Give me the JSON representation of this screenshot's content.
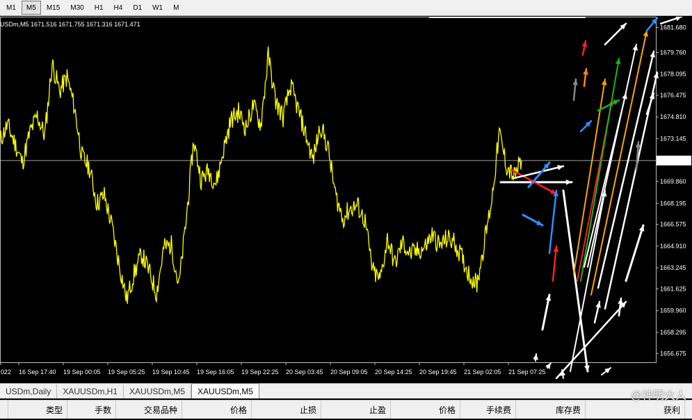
{
  "timeframes": [
    "M1",
    "M5",
    "M15",
    "M30",
    "H1",
    "H4",
    "D1",
    "W1",
    "MN"
  ],
  "active_timeframe": "M5",
  "chart": {
    "info_line": "USDm,M5  1671.516 1671.755 1671.316 1671.471",
    "current_price_label": "1671.471",
    "price_labels": [
      "1681.680",
      "1679.760",
      "1678.095",
      "1676.475",
      "1674.810",
      "1673.145",
      "1671.471",
      "1669.860",
      "1668.195",
      "1666.575",
      "1664.910",
      "1663.245",
      "1661.625",
      "1659.960",
      "1658.295",
      "1656.675"
    ],
    "time_labels": [
      "022",
      "16 Sep 17:40",
      "19 Sep 00:05",
      "19 Sep 05:25",
      "19 Sep 10:45",
      "19 Sep 16:05",
      "19 Sep 22:25",
      "20 Sep 03:45",
      "20 Sep 09:05",
      "20 Sep 14:25",
      "20 Sep 19:45",
      "21 Sep 02:05",
      "21 Sep 07:25"
    ],
    "line_color": "#ffff00",
    "crosshair_color": "#d8d8d8"
  },
  "chart_data": {
    "type": "line",
    "title": "",
    "xlabel": "",
    "ylabel": "",
    "ylim": [
      1656.0,
      1682.5
    ],
    "x": [
      "16 Sep 17:40",
      "19 Sep 00:05",
      "19 Sep 05:25",
      "19 Sep 10:45",
      "19 Sep 16:05",
      "19 Sep 22:25",
      "20 Sep 03:45",
      "20 Sep 09:05",
      "20 Sep 14:25",
      "20 Sep 19:45",
      "21 Sep 02:05",
      "21 Sep 07:25"
    ],
    "series": [
      {
        "values": [
          1673.0,
          1674.2,
          1672.8,
          1671.3,
          1673.6,
          1674.9,
          1673.4,
          1678.9,
          1676.8,
          1677.9,
          1675.5,
          1671.8,
          1670.9,
          1668.2,
          1668.8,
          1666.5,
          1663.5,
          1660.8,
          1662.8,
          1664.3,
          1663.0,
          1661.3,
          1664.8,
          1665.0,
          1661.8,
          1667.0,
          1673.0,
          1670.0,
          1670.7,
          1669.7,
          1672.3,
          1674.6,
          1675.2,
          1674.0,
          1675.7,
          1674.2,
          1679.5,
          1676.0,
          1674.8,
          1677.2,
          1675.4,
          1673.5,
          1671.5,
          1674.2,
          1672.5,
          1668.9,
          1667.0,
          1667.8,
          1668.0,
          1666.8,
          1663.0,
          1662.3,
          1665.5,
          1663.5,
          1665.2,
          1664.3,
          1664.5,
          1664.8,
          1665.8,
          1664.9,
          1665.5,
          1665.2,
          1664.0,
          1662.7,
          1662.0,
          1665.2,
          1668.5,
          1673.6,
          1671.0,
          1670.2,
          1671.5
        ],
        "color": "#ffff00"
      }
    ],
    "current_price": 1671.471,
    "grid": false,
    "legend": "none"
  },
  "tabs": [
    "USDm,Daily",
    "XAUUSDm,H1",
    "XAUUSDm,M5",
    "XAUUSDm,M5"
  ],
  "active_tab": 3,
  "terminal_columns": [
    "",
    "类型",
    "手数",
    "交易品种",
    "价格",
    "止损",
    "止盈",
    "价格",
    "手续费",
    "库存费",
    "获利"
  ],
  "watermark": "@神明大人"
}
